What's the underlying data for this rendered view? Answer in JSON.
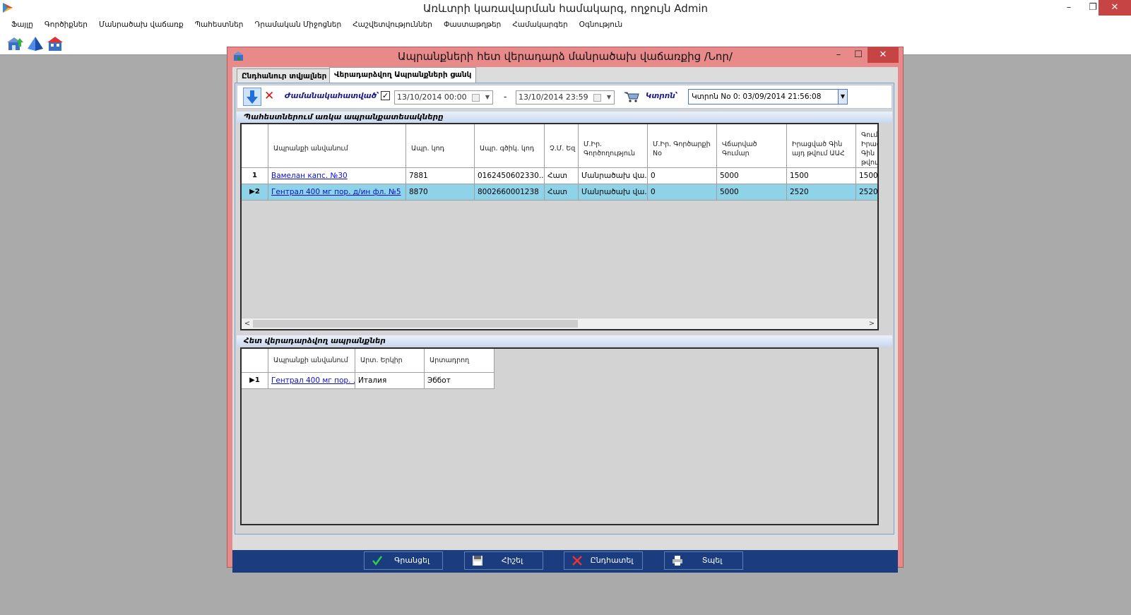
{
  "app": {
    "title": "Առևտրի կառավարման համակարգ, ողջույն Admin"
  },
  "menu": [
    "Ֆայլը",
    "Գործիքներ",
    "Մանրածախ վաճառք",
    "Պահեստներ",
    "Դրամական Միջոցներ",
    "Հաշվետվություններ",
    "Փաստաթղթեր",
    "Համակարգեր",
    "Օգնություն"
  ],
  "window_controls": {
    "minimize": "–",
    "restore": "❐",
    "close": "✕"
  },
  "toolbar": {
    "icons": [
      "warehouse-up-icon",
      "pyramid-icon",
      "building-icon"
    ]
  },
  "dialog": {
    "title": "Ապրանքների հետ վերադարձ մանրածախ վաճառքից /Նոր/",
    "tabs": [
      "Ընդհանուր տվյալներ",
      "Վերադարձվող Ապրանքների ցանկ"
    ],
    "filter": {
      "time_label": "Ժամանակահատված՝",
      "checked": true,
      "date_from": "13/10/2014 00:00",
      "date_to": "13/10/2014 23:59",
      "dash": "-",
      "cart_label": "Կտրոն՝",
      "cart_value": "Կտրոն No 0: 03/09/2014 21:56:08"
    },
    "grid1": {
      "title": "Պահեստներում առկա ապրանքատեսակները",
      "columns": [
        "Ապրանքի անվանում",
        "Ապր. կոդ",
        "Ապր. գծիկ. կոդ",
        "Չ.Մ. Եզ",
        "Մ.Իր. Գործողություն",
        "Մ.Իր. Գործարքի No",
        "Վճարված Գումար",
        "Իրացված Գին այդ թվում ԱԱՀ",
        "Գում. Իրաց. Գին թվում"
      ],
      "rows": [
        {
          "num": "1",
          "name": "Вамелан капс. №30",
          "code": "7881",
          "barcode": "0162450602330...",
          "unit": "Հատ",
          "op": "Մանրածախ վա...",
          "deal": "0",
          "paid": "5000",
          "price": "1500",
          "total": "1500"
        },
        {
          "num": "▶2",
          "name": "Гентрал 400 мг пор. д/ин фл. №5",
          "code": "8870",
          "barcode": "8002660001238",
          "unit": "Հատ",
          "op": "Մանրածախ վա...",
          "deal": "0",
          "paid": "5000",
          "price": "2520",
          "total": "2520"
        }
      ],
      "scroll_left": "<",
      "scroll_right": ">"
    },
    "grid2": {
      "title": "Հետ վերադարձվող ապրանքներ",
      "columns": [
        "Ապրանքի անվանում",
        "Արտ. Երկիր",
        "Արտադրող"
      ],
      "rows": [
        {
          "num": "▶1",
          "name": "Гентрал 400 мг пор. ...",
          "country": "Италия",
          "maker": "Эббот"
        }
      ]
    },
    "buttons": {
      "ok": "Գրանցել",
      "save": "Հիշել",
      "cancel": "Ընդհատել",
      "print": "Տպել"
    }
  },
  "colors": {
    "dialog_frame": "#e8898a",
    "footer": "#1b3c7e",
    "selected_row": "#8fd3e8",
    "close_btn": "#c74444"
  }
}
